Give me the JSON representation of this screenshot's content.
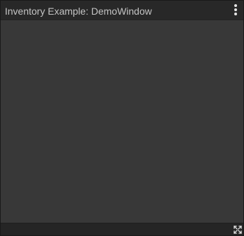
{
  "window": {
    "title": "Inventory Example: DemoWindow"
  },
  "icons": {
    "menu": "kebab-menu-icon",
    "maximize": "maximize-icon"
  },
  "colors": {
    "titlebar_bg": "#282828",
    "content_bg": "#383838",
    "footer_bg": "#252525",
    "title_text": "#c4c4c4",
    "icon": "#e6e6e6"
  }
}
